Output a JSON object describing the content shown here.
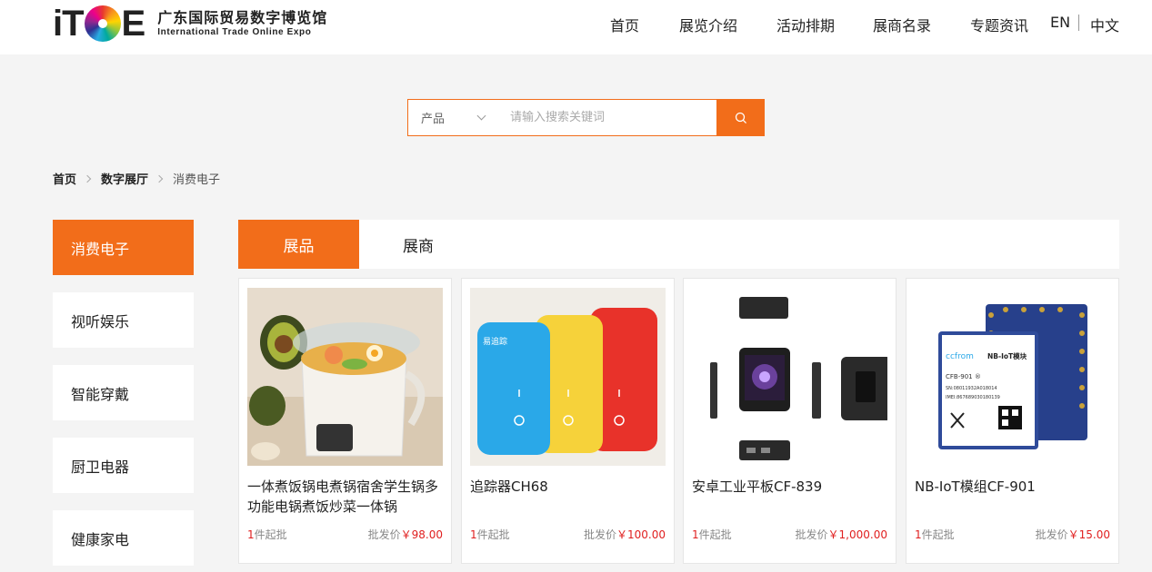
{
  "header": {
    "logo_mark_left": "iT",
    "logo_mark_right": "E",
    "logo_cn": "广东国际贸易数字博览馆",
    "logo_en": "International Trade Online Expo",
    "nav": [
      "首页",
      "展览介绍",
      "活动排期",
      "展商名录",
      "专题资讯"
    ],
    "lang_en": "EN",
    "lang_cn": "中文"
  },
  "search": {
    "category": "产品",
    "placeholder": "请输入搜索关键词",
    "value": ""
  },
  "breadcrumb": [
    "首页",
    "数字展厅",
    "消费电子"
  ],
  "sidebar": [
    "消费电子",
    "视听娱乐",
    "智能穿戴",
    "厨卫电器",
    "健康家电"
  ],
  "tabs": [
    "展品",
    "展商"
  ],
  "products": [
    {
      "name": "一体煮饭锅电煮锅宿舍学生锅多功能电锅煮饭炒菜一体锅",
      "moq_num": "1",
      "moq_label": "件起批",
      "price_label": "批发价",
      "price": "￥98.00"
    },
    {
      "name": "追踪器CH68",
      "moq_num": "1",
      "moq_label": "件起批",
      "price_label": "批发价",
      "price": "￥100.00"
    },
    {
      "name": "安卓工业平板CF-839",
      "moq_num": "1",
      "moq_label": "件起批",
      "price_label": "批发价",
      "price": "￥1,000.00"
    },
    {
      "name": "NB-IoT模组CF-901",
      "moq_num": "1",
      "moq_label": "件起批",
      "price_label": "批发价",
      "price": "￥15.00"
    }
  ],
  "product_image_text": {
    "tracker_brand": "易追踪",
    "module_brand": "ccfrom",
    "module_title": "NB-IoT模块",
    "module_model": "CFB-901 ®",
    "module_sn": "SN:08011932A018014",
    "module_imei": "IMEI:867689030180139"
  },
  "colors": {
    "accent": "#f26d1a",
    "price": "#e02020"
  }
}
